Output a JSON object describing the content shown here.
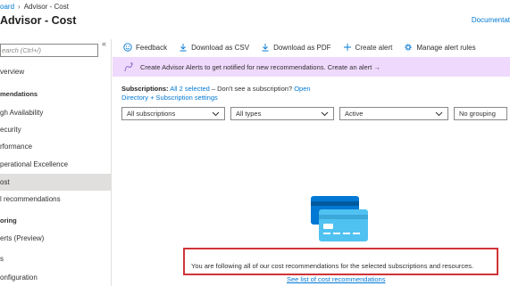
{
  "breadcrumb": {
    "parent": "oard",
    "current": "Advisor - Cost"
  },
  "title": "Advisor - Cost",
  "documentation": "Documentat",
  "sidebar": {
    "search_placeholder": "earch (Ctrl+/)",
    "collapse": "«",
    "items": [
      {
        "label": "verview"
      },
      {
        "label": "mendations"
      },
      {
        "label": "gh Availability"
      },
      {
        "label": "ecurity"
      },
      {
        "label": "rformance"
      },
      {
        "label": "perational Excellence"
      },
      {
        "label": "ost"
      },
      {
        "label": "l recommendations"
      },
      {
        "label": "oring"
      },
      {
        "label": "erts (Preview)"
      },
      {
        "label": "s"
      },
      {
        "label": "onfiguration"
      }
    ]
  },
  "toolbar": {
    "feedback": "Feedback",
    "download_csv": "Download as CSV",
    "download_pdf": "Download as PDF",
    "create_alert": "Create alert",
    "manage_rules": "Manage alert rules"
  },
  "banner": {
    "text": "Create Advisor Alerts to get notified for new recommendations. Create an alert →"
  },
  "subscriptions": {
    "label": "Subscriptions:",
    "selected": "All 2 selected",
    "missing": " – Don't see a subscription? ",
    "open": "Open",
    "settings": "Directory + Subscription settings"
  },
  "filters": {
    "subscriptions": "All subscriptions",
    "types": "All types",
    "status": "Active",
    "grouping": "No grouping"
  },
  "message": "You are following all of our cost recommendations for the selected subscriptions and resources.",
  "cost_link": "See list of cost recommendations",
  "colors": {
    "accent": "#0078d4",
    "banner": "#efd9fd",
    "highlight": "#d13438",
    "selected": "#e1dfdd"
  },
  "icons": {
    "feedback": "smiley-icon",
    "download": "download-icon",
    "create_alert": "plus-icon",
    "manage_rules": "gear-icon",
    "banner": "alert-curve-icon",
    "illustration": "credit-card-icon"
  }
}
